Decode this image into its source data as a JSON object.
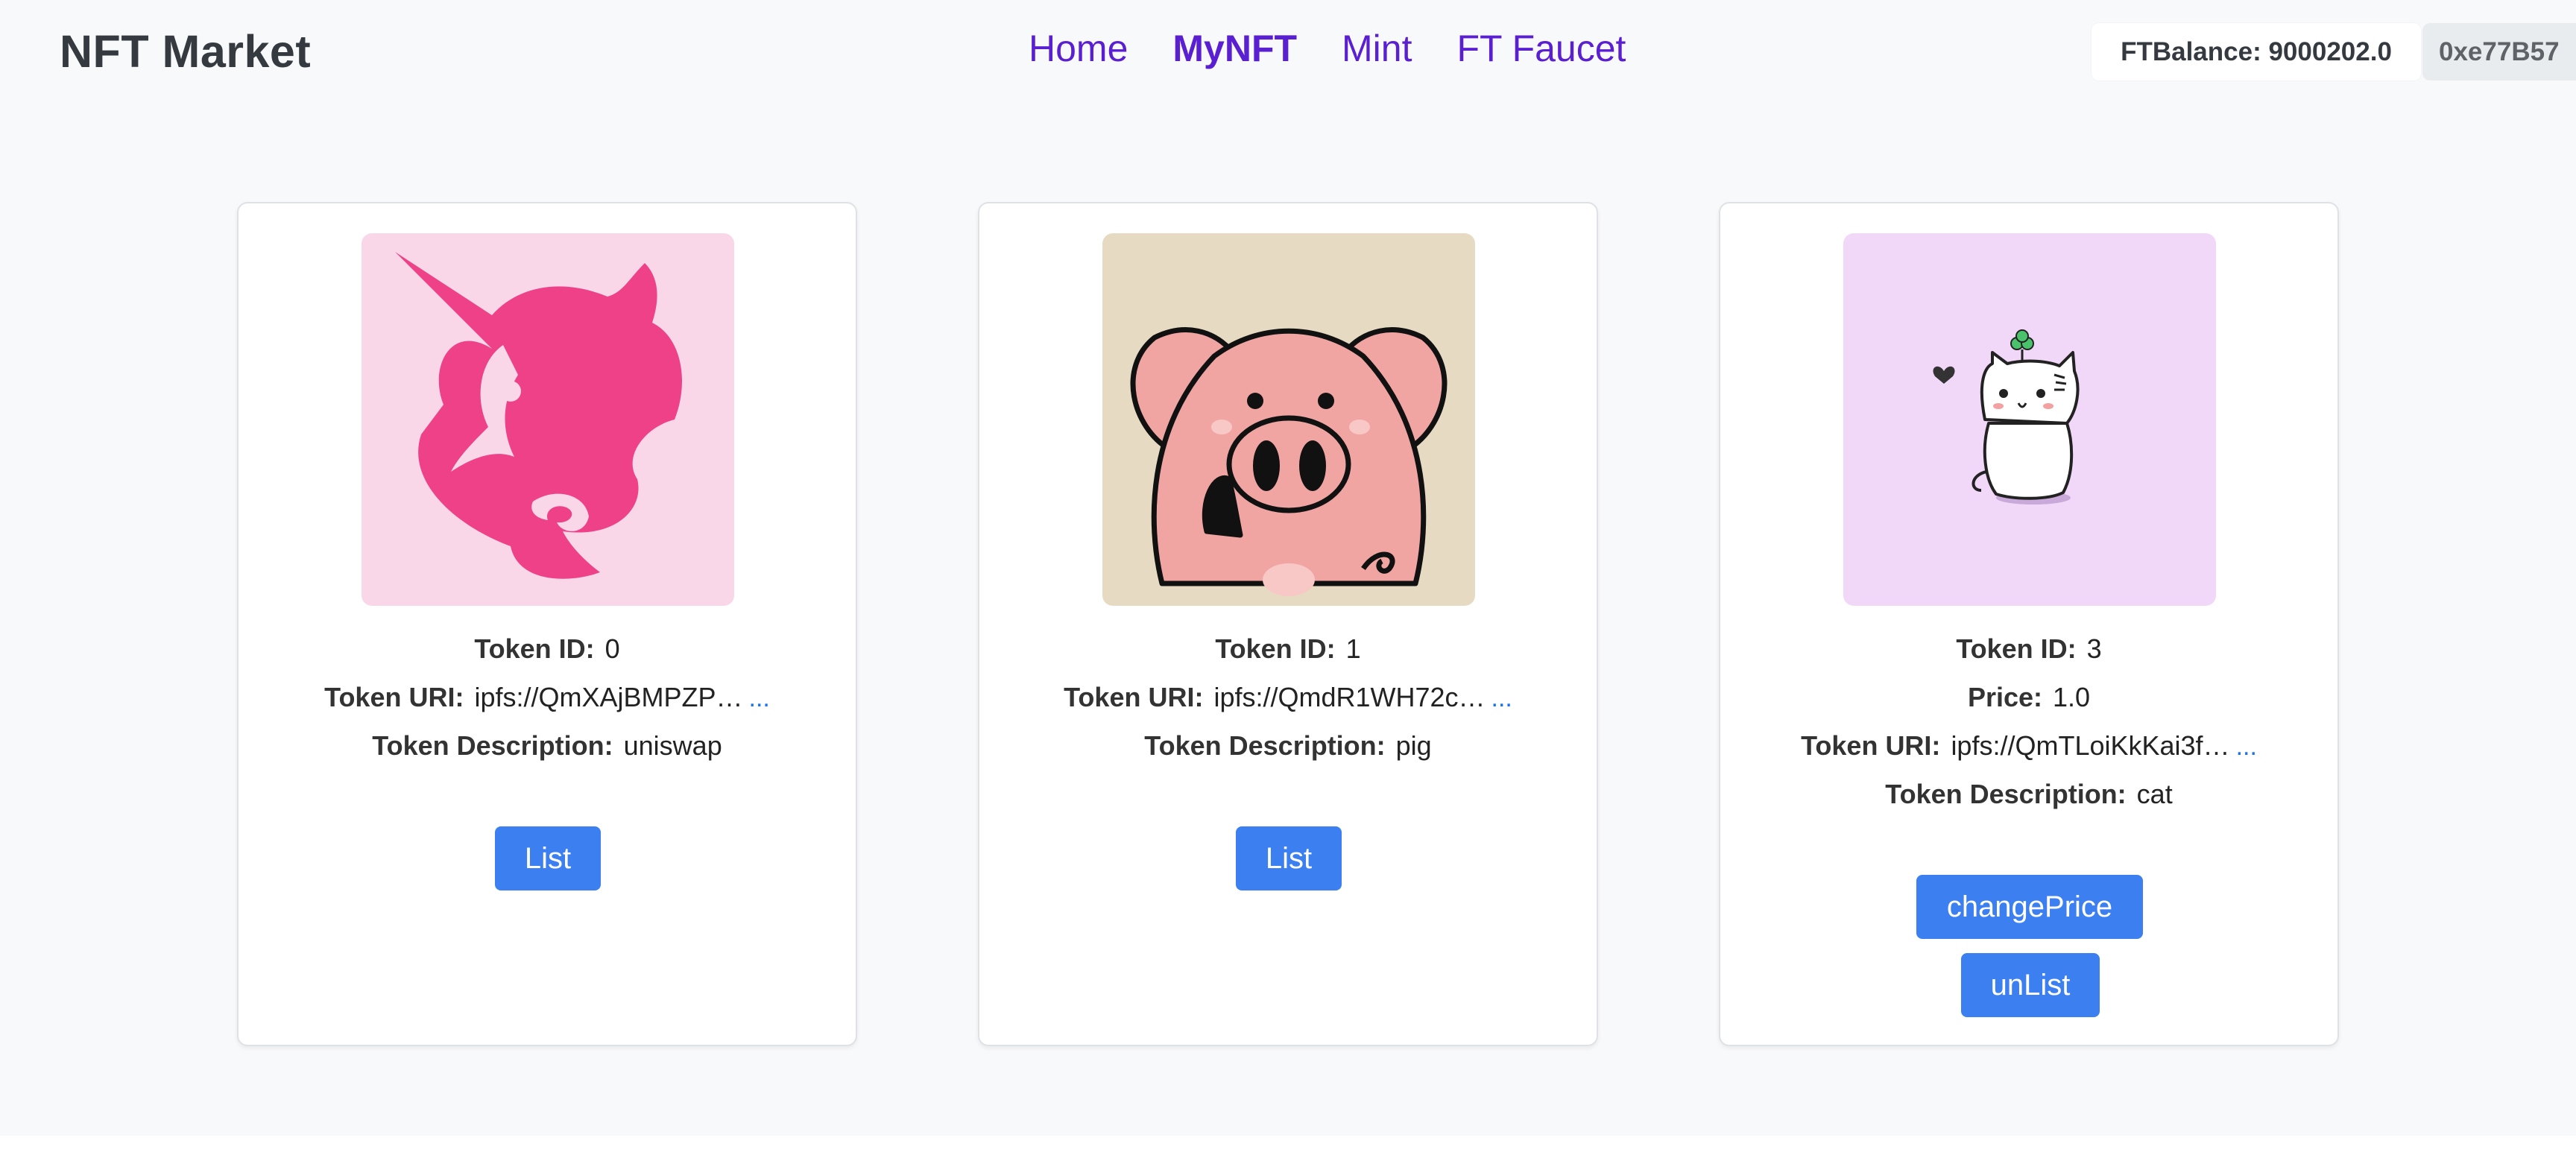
{
  "header": {
    "brand": "NFT Market",
    "nav": [
      {
        "label": "Home",
        "active": false
      },
      {
        "label": "MyNFT",
        "active": true
      },
      {
        "label": "Mint",
        "active": false
      },
      {
        "label": "FT Faucet",
        "active": false
      }
    ],
    "balance": "FTBalance: 9000202.0",
    "address": "0xe77B57"
  },
  "labels": {
    "token_id": "Token ID:",
    "price": "Price:",
    "token_uri": "Token URI:",
    "token_description": "Token Description:",
    "more": "..."
  },
  "cards": [
    {
      "image": "uniswap-unicorn-image",
      "token_id": "0",
      "token_uri": "ipfs://QmXAjBMPZP…",
      "description": "uniswap",
      "buttons": [
        "List"
      ]
    },
    {
      "image": "pig-image",
      "token_id": "1",
      "token_uri": "ipfs://QmdR1WH72c…",
      "description": "pig",
      "buttons": [
        "List"
      ]
    },
    {
      "image": "cat-image",
      "token_id": "3",
      "price": "1.0",
      "token_uri": "ipfs://QmTLoiKkKai3f…",
      "description": "cat",
      "buttons": [
        "changePrice",
        "unList"
      ]
    }
  ],
  "colors": {
    "accent": "#3b7ff1",
    "nav": "#5a1fd1",
    "background": "#f8f9fa"
  }
}
